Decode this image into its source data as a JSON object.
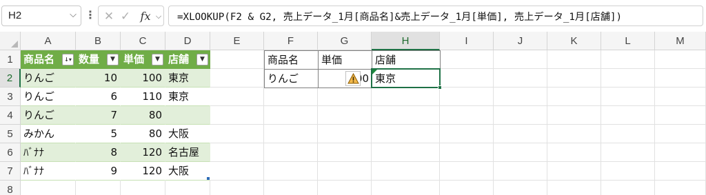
{
  "formula_bar": {
    "name_box": "H2",
    "name_box_dropdown_icon": "chevron-down-icon",
    "separator_icon": "vertical-dots-icon",
    "cancel_glyph": "✕",
    "enter_glyph": "✓",
    "fx_label": "fx",
    "formula": "=XLOOKUP(F2 & G2, 売上データ_1月[商品名]&売上データ_1月[単価], 売上データ_1月[店舗])"
  },
  "columns": [
    "A",
    "B",
    "C",
    "D",
    "E",
    "F",
    "G",
    "H",
    "I",
    "J",
    "K",
    "L",
    "M"
  ],
  "rows": [
    "1",
    "2",
    "3",
    "4",
    "5",
    "6",
    "7",
    "8"
  ],
  "selected_cell": {
    "column": "H",
    "row": "2"
  },
  "table": {
    "name": "売上データ_1月",
    "headers": [
      "商品名",
      "数量",
      "単価",
      "店舗"
    ],
    "sort_indicator_on_first_header": true,
    "rows": [
      [
        "りんご",
        "10",
        "100",
        "東京"
      ],
      [
        "りんご",
        "6",
        "110",
        "東京"
      ],
      [
        "りんご",
        "7",
        "80",
        ""
      ],
      [
        "みかん",
        "5",
        "80",
        "大阪"
      ],
      [
        "ﾊﾞﾅﾅ",
        "8",
        "120",
        "名古屋"
      ],
      [
        "ﾊﾞﾅﾅ",
        "9",
        "120",
        "大阪"
      ]
    ]
  },
  "lookup": {
    "headers": [
      "商品名",
      "単価",
      "店舗"
    ],
    "values": [
      "りんご",
      "00",
      "東京"
    ],
    "warning_icon": "warning-icon"
  },
  "colors": {
    "table_header": "#70ad47",
    "table_band": "#e2efda",
    "selection": "#1e7145"
  }
}
